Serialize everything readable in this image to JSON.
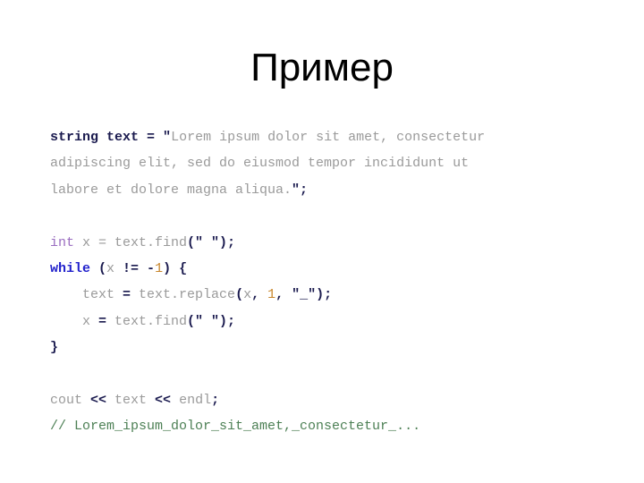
{
  "slide": {
    "title": "Пример",
    "background_color": "#ffffff",
    "title_color": "#000000"
  },
  "palette": {
    "punctuation": "#1b1b4f",
    "declaration": "#1b1b4f",
    "plain": "#9a9a9a",
    "string": "#9a9a9a",
    "type": "#9a6dc0",
    "keyword": "#2222cc",
    "number": "#c8862c",
    "comment": "#4d8055"
  },
  "code": {
    "language": "cpp",
    "lines": [
      {
        "id": "line-string-decl-1",
        "tokens": [
          {
            "cls": "tk-decl",
            "text": "string text "
          },
          {
            "cls": "tk-punct",
            "text": "= "
          },
          {
            "cls": "tk-punct",
            "text": "\""
          },
          {
            "cls": "tk-str",
            "text": "Lorem ipsum dolor sit amet, consectetur"
          }
        ]
      },
      {
        "id": "line-string-decl-2",
        "tokens": [
          {
            "cls": "tk-str",
            "text": "adipiscing elit, sed do eiusmod tempor incididunt ut"
          }
        ]
      },
      {
        "id": "line-string-decl-3",
        "tokens": [
          {
            "cls": "tk-str",
            "text": "labore et dolore magna aliqua."
          },
          {
            "cls": "tk-punct",
            "text": "\";"
          }
        ]
      },
      {
        "id": "line-blank-1",
        "blank": true,
        "tokens": []
      },
      {
        "id": "line-int-find",
        "tokens": [
          {
            "cls": "tk-type",
            "text": "int"
          },
          {
            "cls": "tk-plain",
            "text": " x = text.find"
          },
          {
            "cls": "tk-punct",
            "text": "(\" \");"
          }
        ]
      },
      {
        "id": "line-while",
        "tokens": [
          {
            "cls": "tk-kw",
            "text": "while"
          },
          {
            "cls": "tk-punct",
            "text": " ("
          },
          {
            "cls": "tk-plain",
            "text": "x "
          },
          {
            "cls": "tk-punct",
            "text": "!= -"
          },
          {
            "cls": "tk-num",
            "text": "1"
          },
          {
            "cls": "tk-punct",
            "text": ") {"
          }
        ]
      },
      {
        "id": "line-replace",
        "tokens": [
          {
            "cls": "tk-plain",
            "text": "    text "
          },
          {
            "cls": "tk-punct",
            "text": "= "
          },
          {
            "cls": "tk-plain",
            "text": "text.replace"
          },
          {
            "cls": "tk-punct",
            "text": "("
          },
          {
            "cls": "tk-plain",
            "text": "x"
          },
          {
            "cls": "tk-punct",
            "text": ", "
          },
          {
            "cls": "tk-num",
            "text": "1"
          },
          {
            "cls": "tk-punct",
            "text": ", \"_\");"
          }
        ]
      },
      {
        "id": "line-find-again",
        "tokens": [
          {
            "cls": "tk-plain",
            "text": "    x "
          },
          {
            "cls": "tk-punct",
            "text": "= "
          },
          {
            "cls": "tk-plain",
            "text": "text.find"
          },
          {
            "cls": "tk-punct",
            "text": "(\" \");"
          }
        ]
      },
      {
        "id": "line-close-brace",
        "tokens": [
          {
            "cls": "tk-punct",
            "text": "}"
          }
        ]
      },
      {
        "id": "line-blank-2",
        "blank": true,
        "tokens": []
      },
      {
        "id": "line-cout",
        "tokens": [
          {
            "cls": "tk-plain",
            "text": "cout "
          },
          {
            "cls": "tk-punct",
            "text": "<< "
          },
          {
            "cls": "tk-plain",
            "text": "text "
          },
          {
            "cls": "tk-punct",
            "text": "<< "
          },
          {
            "cls": "tk-plain",
            "text": "endl"
          },
          {
            "cls": "tk-punct",
            "text": ";"
          }
        ]
      },
      {
        "id": "line-comment",
        "tokens": [
          {
            "cls": "tk-comment",
            "text": "// Lorem_ipsum_dolor_sit_amet,_consectetur_..."
          }
        ]
      }
    ]
  }
}
